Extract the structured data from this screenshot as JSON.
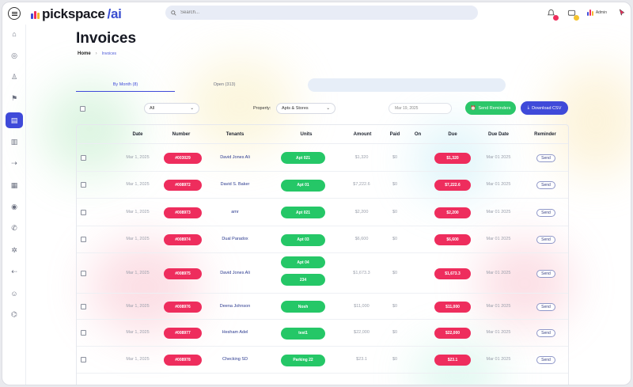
{
  "brand": {
    "name": "pickspace",
    "suffix": "/ai",
    "colors": [
      "#3f4ad9",
      "#ee2d5d",
      "#f5b82e"
    ]
  },
  "search": {
    "placeholder": "Search..."
  },
  "header": {
    "admin_label": "Admin"
  },
  "sidebar": {
    "items": [
      {
        "icon": "home-icon"
      },
      {
        "icon": "location-icon"
      },
      {
        "icon": "user-icon"
      },
      {
        "icon": "flag-icon"
      },
      {
        "icon": "invoice-icon",
        "active": true
      },
      {
        "icon": "document-icon"
      },
      {
        "icon": "transfer-icon"
      },
      {
        "icon": "table-icon"
      },
      {
        "icon": "coin-icon"
      },
      {
        "icon": "phone-icon"
      },
      {
        "icon": "settings-icon"
      },
      {
        "icon": "share-icon"
      },
      {
        "icon": "people-icon"
      },
      {
        "icon": "bell-icon"
      }
    ]
  },
  "page": {
    "title": "Invoices",
    "breadcrumb": {
      "home": "Home",
      "current": "Invoices"
    },
    "tabs": [
      {
        "label": "By Month (8)",
        "active": true
      },
      {
        "label": "Open (313)",
        "active": false
      }
    ]
  },
  "filters": {
    "status_value": "All",
    "property_label": "Property:",
    "property_value": "Apts & Stores",
    "date_value": "Mar 19, 2025",
    "send_reminders_label": "Send Reminders",
    "download_csv_label": "Download CSV"
  },
  "table": {
    "headers": {
      "date": "Date",
      "number": "Number",
      "tenants": "Tenants",
      "units": "Units",
      "amount": "Amount",
      "paid": "Paid",
      "on": "On",
      "due": "Due",
      "due_date": "Due Date",
      "reminder": "Reminder"
    },
    "send_label": "Send",
    "rows": [
      {
        "date": "Mar 1, 2025",
        "number": "#003029",
        "tenant": "David Jones Ali",
        "units": [
          "Apt 021"
        ],
        "amount": "$1,320",
        "paid": "$0",
        "due": "$1,320",
        "due_date": "Mar 01 2025"
      },
      {
        "date": "Mar 1, 2025",
        "number": "#008972",
        "tenant": "David S. Baker",
        "units": [
          "Apt 01"
        ],
        "amount": "$7,222.6",
        "paid": "$0",
        "due": "$7,222.6",
        "due_date": "Mar 01 2025"
      },
      {
        "date": "Mar 1, 2025",
        "number": "#008973",
        "tenant": "amr",
        "units": [
          "Apt 021"
        ],
        "amount": "$2,200",
        "paid": "$0",
        "due": "$2,200",
        "due_date": "Mar 01 2025"
      },
      {
        "date": "Mar 1, 2025",
        "number": "#008974",
        "tenant": "Dual Paradox",
        "units": [
          "Apt 03"
        ],
        "amount": "$6,600",
        "paid": "$0",
        "due": "$6,600",
        "due_date": "Mar 01 2025"
      },
      {
        "date": "Mar 1, 2025",
        "number": "#008975",
        "tenant": "David Jones Ali",
        "units": [
          "Apt 04",
          "234"
        ],
        "amount": "$1,673.3",
        "paid": "$0",
        "due": "$1,673.3",
        "due_date": "Mar 01 2025"
      },
      {
        "date": "Mar 1, 2025",
        "number": "#008976",
        "tenant": "Deena Johnson",
        "units": [
          "Nosh"
        ],
        "amount": "$11,000",
        "paid": "$0",
        "due": "$11,000",
        "due_date": "Mar 01 2025"
      },
      {
        "date": "Mar 1, 2025",
        "number": "#008977",
        "tenant": "Hesham Adel",
        "units": [
          "test1"
        ],
        "amount": "$22,000",
        "paid": "$0",
        "due": "$22,000",
        "due_date": "Mar 01 2025"
      },
      {
        "date": "Mar 1, 2025",
        "number": "#008978",
        "tenant": "Checking SD",
        "units": [
          "Parking 22"
        ],
        "amount": "$23.1",
        "paid": "$0",
        "due": "$23.1",
        "due_date": "Mar 01 2025"
      }
    ]
  }
}
